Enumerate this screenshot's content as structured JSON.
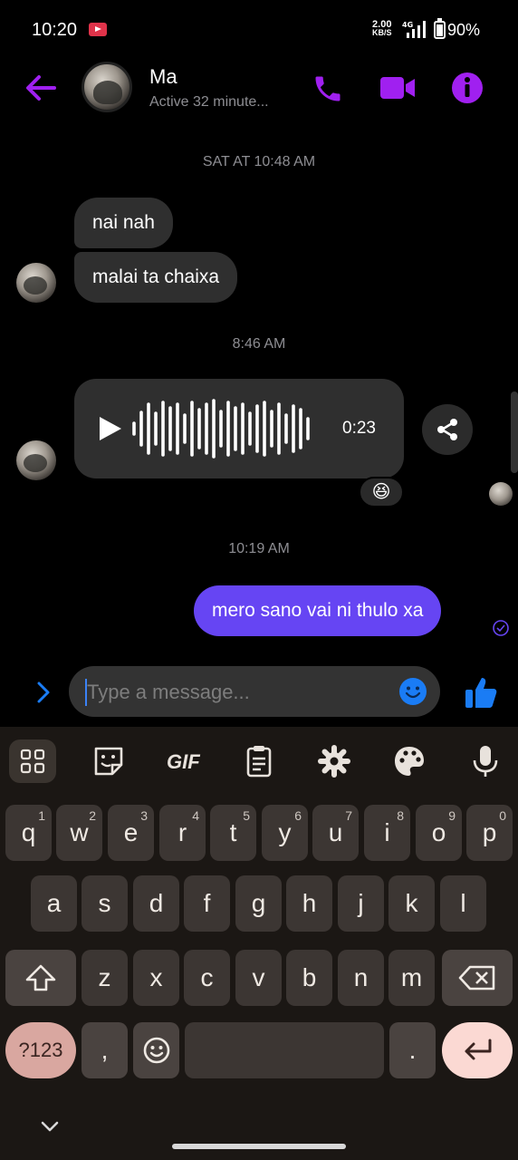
{
  "status_bar": {
    "time": "10:20",
    "net_speed_value": "2.00",
    "net_speed_unit": "KB/S",
    "signal_label": "4G",
    "battery": "90%"
  },
  "header": {
    "contact_name": "Ma",
    "contact_status": "Active 32 minute..."
  },
  "conversation": {
    "timestamps": [
      "SAT AT 10:48 AM",
      "8:46 AM",
      "10:19 AM"
    ],
    "incoming_messages": [
      "nai nah",
      "malai ta chaixa"
    ],
    "voice_message": {
      "duration": "0:23"
    },
    "reaction_emoji": "😆",
    "outgoing_messages": [
      "mero sano vai ni thulo xa"
    ]
  },
  "composer": {
    "placeholder": "Type a message..."
  },
  "keyboard": {
    "toolbar": [
      "apps",
      "sticker",
      "GIF",
      "clipboard",
      "settings",
      "theme",
      "mic"
    ],
    "gif_label": "GIF",
    "row1": [
      {
        "key": "q",
        "hint": "1"
      },
      {
        "key": "w",
        "hint": "2"
      },
      {
        "key": "e",
        "hint": "3"
      },
      {
        "key": "r",
        "hint": "4"
      },
      {
        "key": "t",
        "hint": "5"
      },
      {
        "key": "y",
        "hint": "6"
      },
      {
        "key": "u",
        "hint": "7"
      },
      {
        "key": "i",
        "hint": "8"
      },
      {
        "key": "o",
        "hint": "9"
      },
      {
        "key": "p",
        "hint": "0"
      }
    ],
    "row2": [
      "a",
      "s",
      "d",
      "f",
      "g",
      "h",
      "j",
      "k",
      "l"
    ],
    "row3": [
      "z",
      "x",
      "c",
      "v",
      "b",
      "n",
      "m"
    ],
    "symbols_label": "?123",
    "comma": ",",
    "period": ".",
    "space_label": ""
  },
  "colors": {
    "accent": "#a020f0",
    "outgoing_bubble": "#6645f3",
    "incoming_bubble": "#2f2f2f",
    "like_blue": "#1a7cf5",
    "keyboard_bg": "#1b1714"
  },
  "icons": {
    "back": "arrow-left-icon",
    "call": "phone-icon",
    "video": "video-camera-icon",
    "info": "info-icon",
    "play": "play-icon",
    "share": "share-icon",
    "emoji": "smiley-icon",
    "like": "thumbs-up-icon",
    "expand": "chevron-right-icon"
  }
}
